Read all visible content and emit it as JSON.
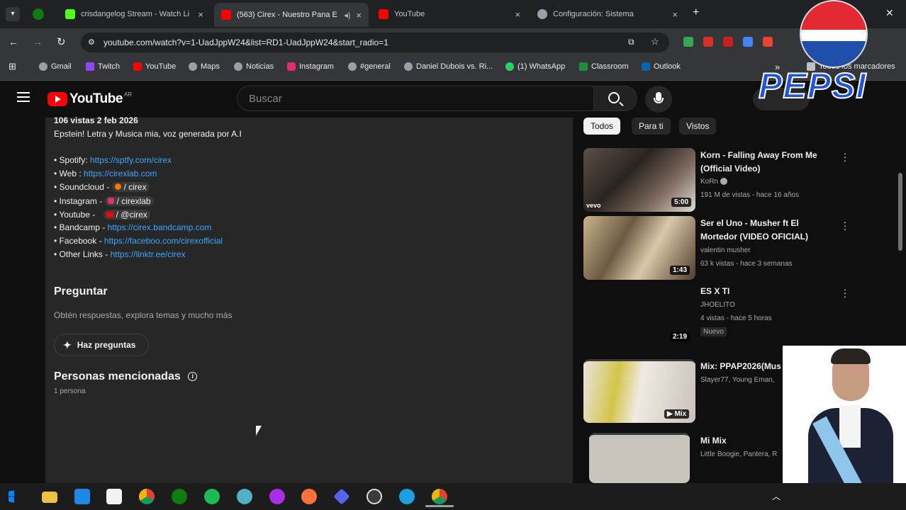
{
  "tabs": [
    {
      "title": "crisdangelog Stream - Watch Li",
      "close": "×"
    },
    {
      "title": "(563) Cirex - Nuestro Pana E",
      "close": "×"
    },
    {
      "title": "YouTube",
      "close": "×"
    },
    {
      "title": "Configuración: Sistema",
      "close": "×"
    }
  ],
  "new_tab": "+",
  "window_close": "✕",
  "address": "youtube.com/watch?v=1-UadJppW24&list=RD1-UadJppW24&start_radio=1",
  "bookmarks": [
    "Gmail",
    "Twitch",
    "YouTube",
    "Maps",
    "Noticias",
    "Instagram",
    "#general",
    "Daniel Dubois vs. Ri...",
    "(1) WhatsApp",
    "Classroom",
    "Outlook"
  ],
  "bookmarks_all": "Todos los marcadores",
  "bookmarks_more": "»",
  "yt": {
    "logo_text": "YouTube",
    "country": "AR",
    "search_placeholder": "Buscar"
  },
  "overlay_pepsi": "PEPSI",
  "description": {
    "meta": "106 vistas  2 feb 2026",
    "intro": "Epstein! Letra y Musica mia, voz generada por A.I",
    "links": [
      {
        "label": "• Spotify: ",
        "value": "https://sptfy.com/cirex"
      },
      {
        "label": "• Web : ",
        "value": "https://cirexlab.com"
      },
      {
        "label": "• Soundcloud - ",
        "value": "/ cirex"
      },
      {
        "label": "• Instagram - ",
        "value": "/ cirexlab"
      },
      {
        "label": "• Youtube - ",
        "value": "/ @cirex"
      },
      {
        "label": "• Bandcamp  - ",
        "value": "https://cirex.bandcamp.com"
      },
      {
        "label": "• Facebook  - ",
        "value": "https://faceboo.com/cirexofficial"
      },
      {
        "label": "• Other Links - ",
        "value": "https://linktr.ee/cirex"
      }
    ],
    "ask_title": "Preguntar",
    "ask_sub": "Obtén respuestas, explora temas y mucho más",
    "ask_button": "Haz preguntas",
    "people_title": "Personas mencionadas",
    "people_count": "1 persona"
  },
  "chips": [
    "Todos",
    "Para ti",
    "Vistos"
  ],
  "videos": [
    {
      "title": "Korn - Falling Away From Me (Official Video)",
      "channel": "KoRn",
      "meta": "191 M de vistas - hace 16 años",
      "duration": "5:00",
      "badge": "vevo"
    },
    {
      "title": "Ser el Uno - Musher ft El Mortedor (VIDEO OFICIAL)",
      "channel": "valentin musher",
      "meta": "63 k vistas - hace 3 semanas",
      "duration": "1:43"
    },
    {
      "title": "ES X TI",
      "channel": "JHOELITO",
      "meta": "4 vistas - hace 5 horas",
      "duration": "2:19",
      "badge": "Nuevo"
    },
    {
      "title": "Mix: PPAP2026(Mus",
      "channel": "Slayer77, Young Eman,",
      "duration": "Mix"
    },
    {
      "title": "Mi Mix",
      "channel": "Little Boogie, Pantera, R"
    }
  ],
  "colors": {
    "link": "#3ea6ff",
    "yt_red": "#ff0000",
    "pepsi_blue": "#0b3fa8"
  }
}
